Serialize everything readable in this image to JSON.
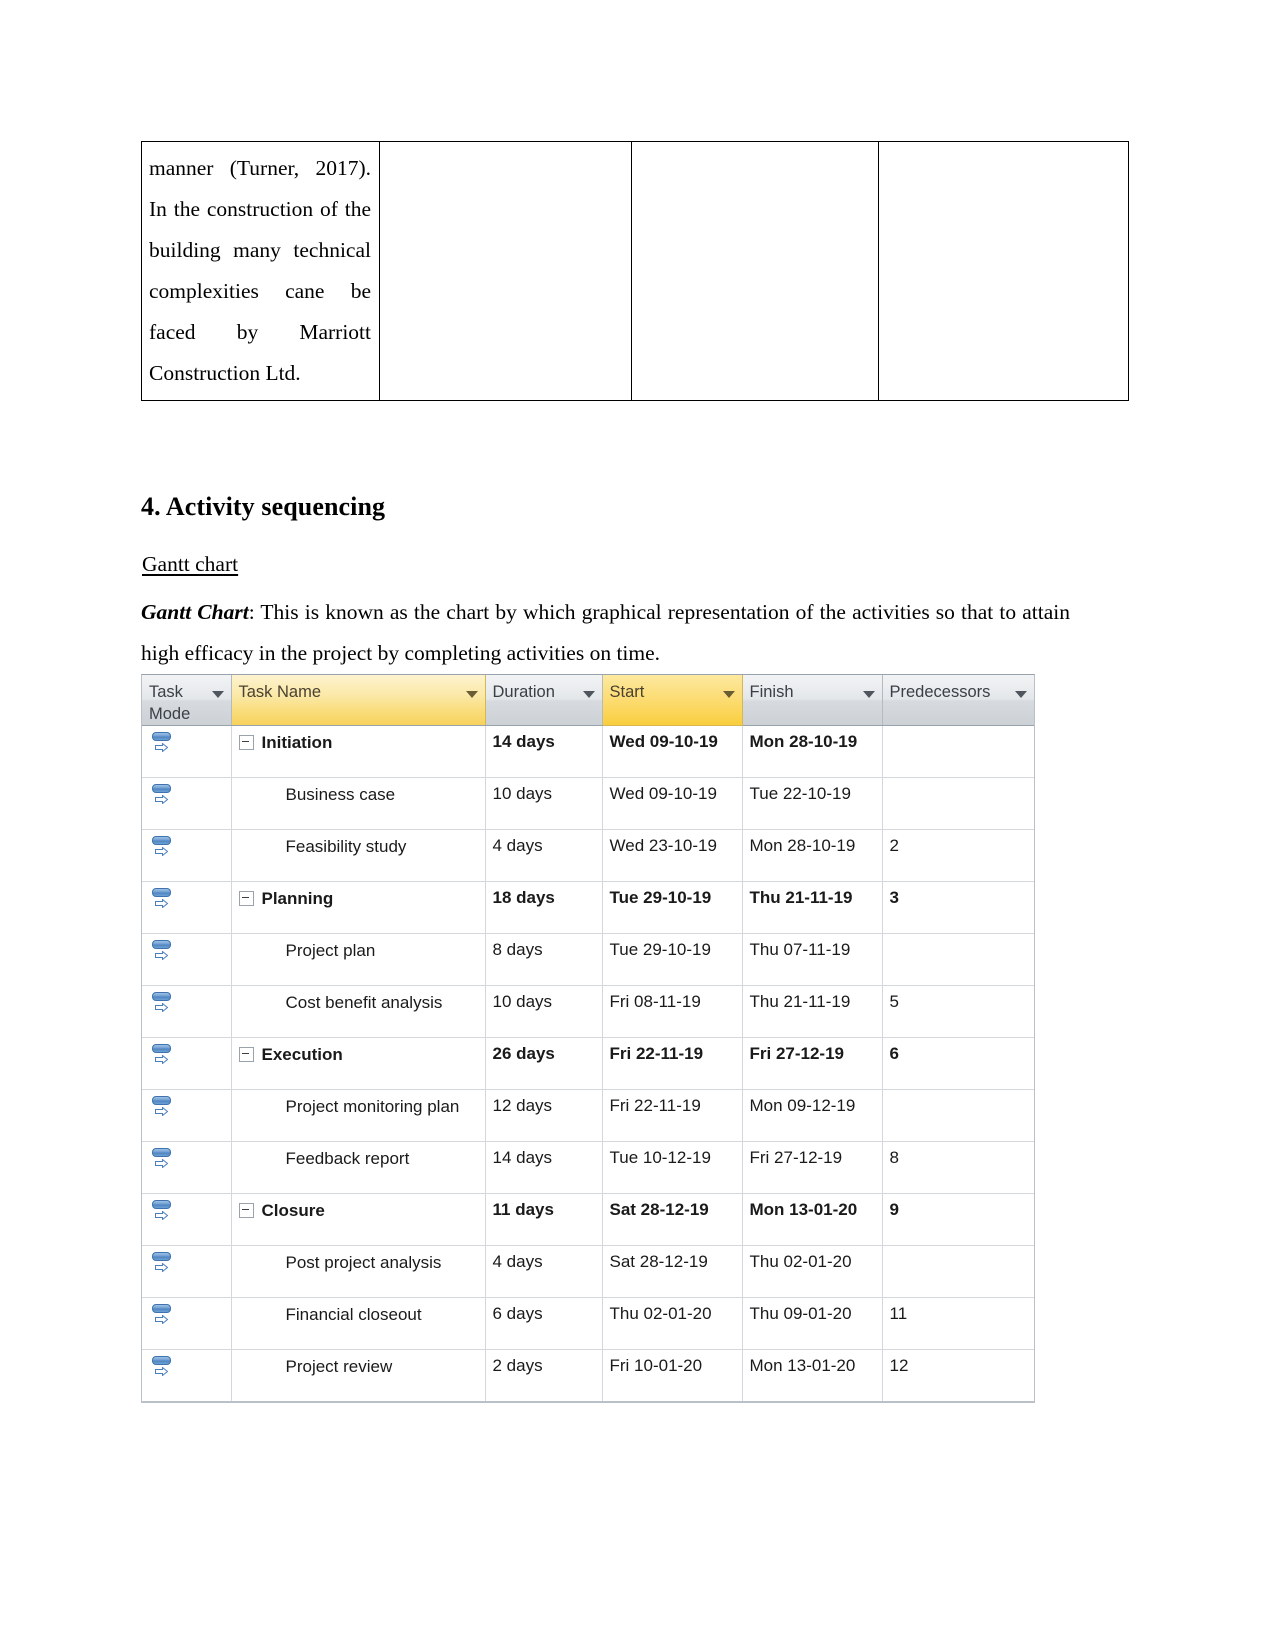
{
  "document": {
    "top_table": {
      "cell1_paragraph": "manner (Turner, 2017). In the construction of the building many technical complexities cane be faced by Marriott Construction Ltd.",
      "cell2": "",
      "cell3": "",
      "cell4": ""
    },
    "section_heading": "4. Activity sequencing",
    "sub_heading": "Gantt chart",
    "paragraph_lead": "Gantt Chart",
    "paragraph_rest": ": This is known as the chart by which graphical representation of the activities so that to attain high efficacy in the project by completing activities on time."
  },
  "gantt": {
    "columns": [
      {
        "key": "task_mode",
        "label": "Task Mode",
        "highlight": "none"
      },
      {
        "key": "task_name",
        "label": "Task Name",
        "highlight": "soft"
      },
      {
        "key": "duration",
        "label": "Duration",
        "highlight": "none"
      },
      {
        "key": "start",
        "label": "Start",
        "highlight": "strong"
      },
      {
        "key": "finish",
        "label": "Finish",
        "highlight": "none"
      },
      {
        "key": "predecessors",
        "label": "Predecessors",
        "highlight": "none"
      }
    ],
    "colors": {
      "header_gray": "#d7dbdf",
      "header_yellow_soft": "#fbe9a8",
      "header_yellow_strong": "#f9cd3c",
      "grid_line": "#d4d8dc",
      "icon_blue": "#4e83c0"
    },
    "rows": [
      {
        "level": 1,
        "name": "Initiation",
        "duration": "14 days",
        "start": "Wed 09-10-19",
        "finish": "Mon 28-10-19",
        "predecessors": ""
      },
      {
        "level": 2,
        "name": "Business case",
        "duration": "10 days",
        "start": "Wed 09-10-19",
        "finish": "Tue 22-10-19",
        "predecessors": ""
      },
      {
        "level": 2,
        "name": "Feasibility study",
        "duration": "4 days",
        "start": "Wed 23-10-19",
        "finish": "Mon 28-10-19",
        "predecessors": "2"
      },
      {
        "level": 1,
        "name": "Planning",
        "duration": "18 days",
        "start": "Tue 29-10-19",
        "finish": "Thu 21-11-19",
        "predecessors": "3"
      },
      {
        "level": 2,
        "name": "Project plan",
        "duration": "8 days",
        "start": "Tue 29-10-19",
        "finish": "Thu 07-11-19",
        "predecessors": ""
      },
      {
        "level": 2,
        "name": "Cost benefit analysis",
        "duration": "10 days",
        "start": "Fri 08-11-19",
        "finish": "Thu 21-11-19",
        "predecessors": "5"
      },
      {
        "level": 1,
        "name": "Execution",
        "duration": "26 days",
        "start": "Fri 22-11-19",
        "finish": "Fri 27-12-19",
        "predecessors": "6"
      },
      {
        "level": 2,
        "name": "Project monitoring plan",
        "duration": "12 days",
        "start": "Fri 22-11-19",
        "finish": "Mon 09-12-19",
        "predecessors": ""
      },
      {
        "level": 2,
        "name": "Feedback report",
        "duration": "14 days",
        "start": "Tue 10-12-19",
        "finish": "Fri 27-12-19",
        "predecessors": "8"
      },
      {
        "level": 1,
        "name": "Closure",
        "duration": "11 days",
        "start": "Sat 28-12-19",
        "finish": "Mon 13-01-20",
        "predecessors": "9"
      },
      {
        "level": 2,
        "name": "Post project analysis",
        "duration": "4 days",
        "start": "Sat 28-12-19",
        "finish": "Thu 02-01-20",
        "predecessors": ""
      },
      {
        "level": 2,
        "name": "Financial closeout",
        "duration": "6 days",
        "start": "Thu 02-01-20",
        "finish": "Thu 09-01-20",
        "predecessors": "11"
      },
      {
        "level": 2,
        "name": "Project review",
        "duration": "2 days",
        "start": "Fri 10-01-20",
        "finish": "Mon 13-01-20",
        "predecessors": "12"
      }
    ]
  }
}
